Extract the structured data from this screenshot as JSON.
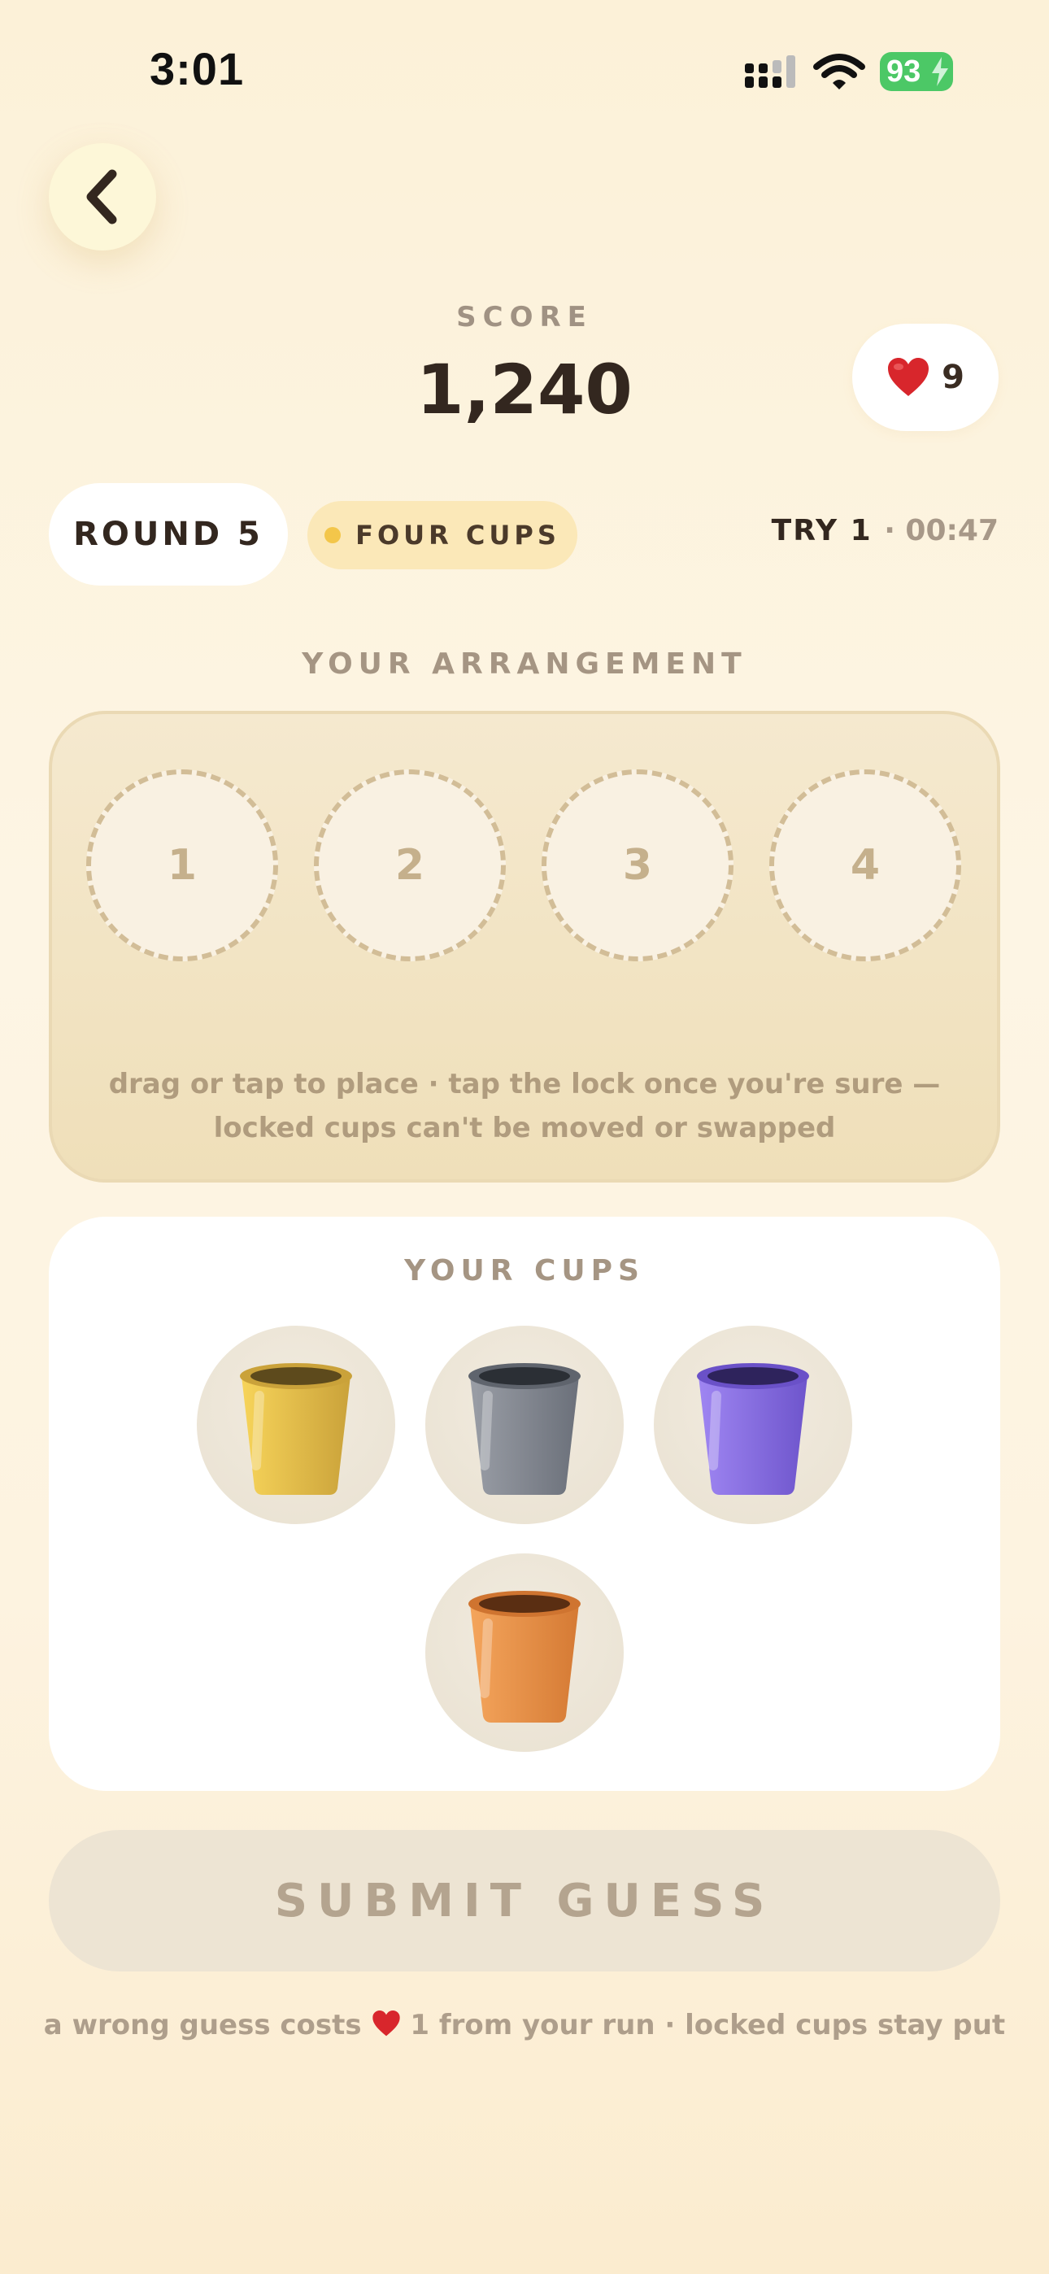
{
  "status_bar": {
    "time": "3:01",
    "battery": "93"
  },
  "header": {
    "score_label": "SCORE",
    "score_value": "1,240",
    "lives": "9",
    "icons": {
      "back": "chevron-left-icon",
      "heart": "heart-icon"
    }
  },
  "round": {
    "label": "ROUND 5",
    "mode": "FOUR CUPS",
    "try": "TRY 1",
    "timer": "· 00:47"
  },
  "arrangement": {
    "label": "YOUR ARRANGEMENT",
    "slots": [
      "1",
      "2",
      "3",
      "4"
    ],
    "hint_line1": "drag or tap to place · tap the lock once you're sure —",
    "hint_line2": "locked cups can't be moved or swapped"
  },
  "cups": {
    "label": "YOUR CUPS",
    "items": [
      {
        "name": "yellow",
        "color": "#f2c94c"
      },
      {
        "name": "gray",
        "color": "#868b95"
      },
      {
        "name": "purple",
        "color": "#8e74ea"
      },
      {
        "name": "orange",
        "color": "#ec9448"
      }
    ]
  },
  "actions": {
    "submit": "SUBMIT GUESS"
  },
  "footer": {
    "before_heart": "a wrong guess costs",
    "after_heart": "1 from your run · locked cups stay put"
  },
  "colors": {
    "accent": "#f3c64a",
    "heart": "#d8262c",
    "battery": "#4cc866"
  }
}
